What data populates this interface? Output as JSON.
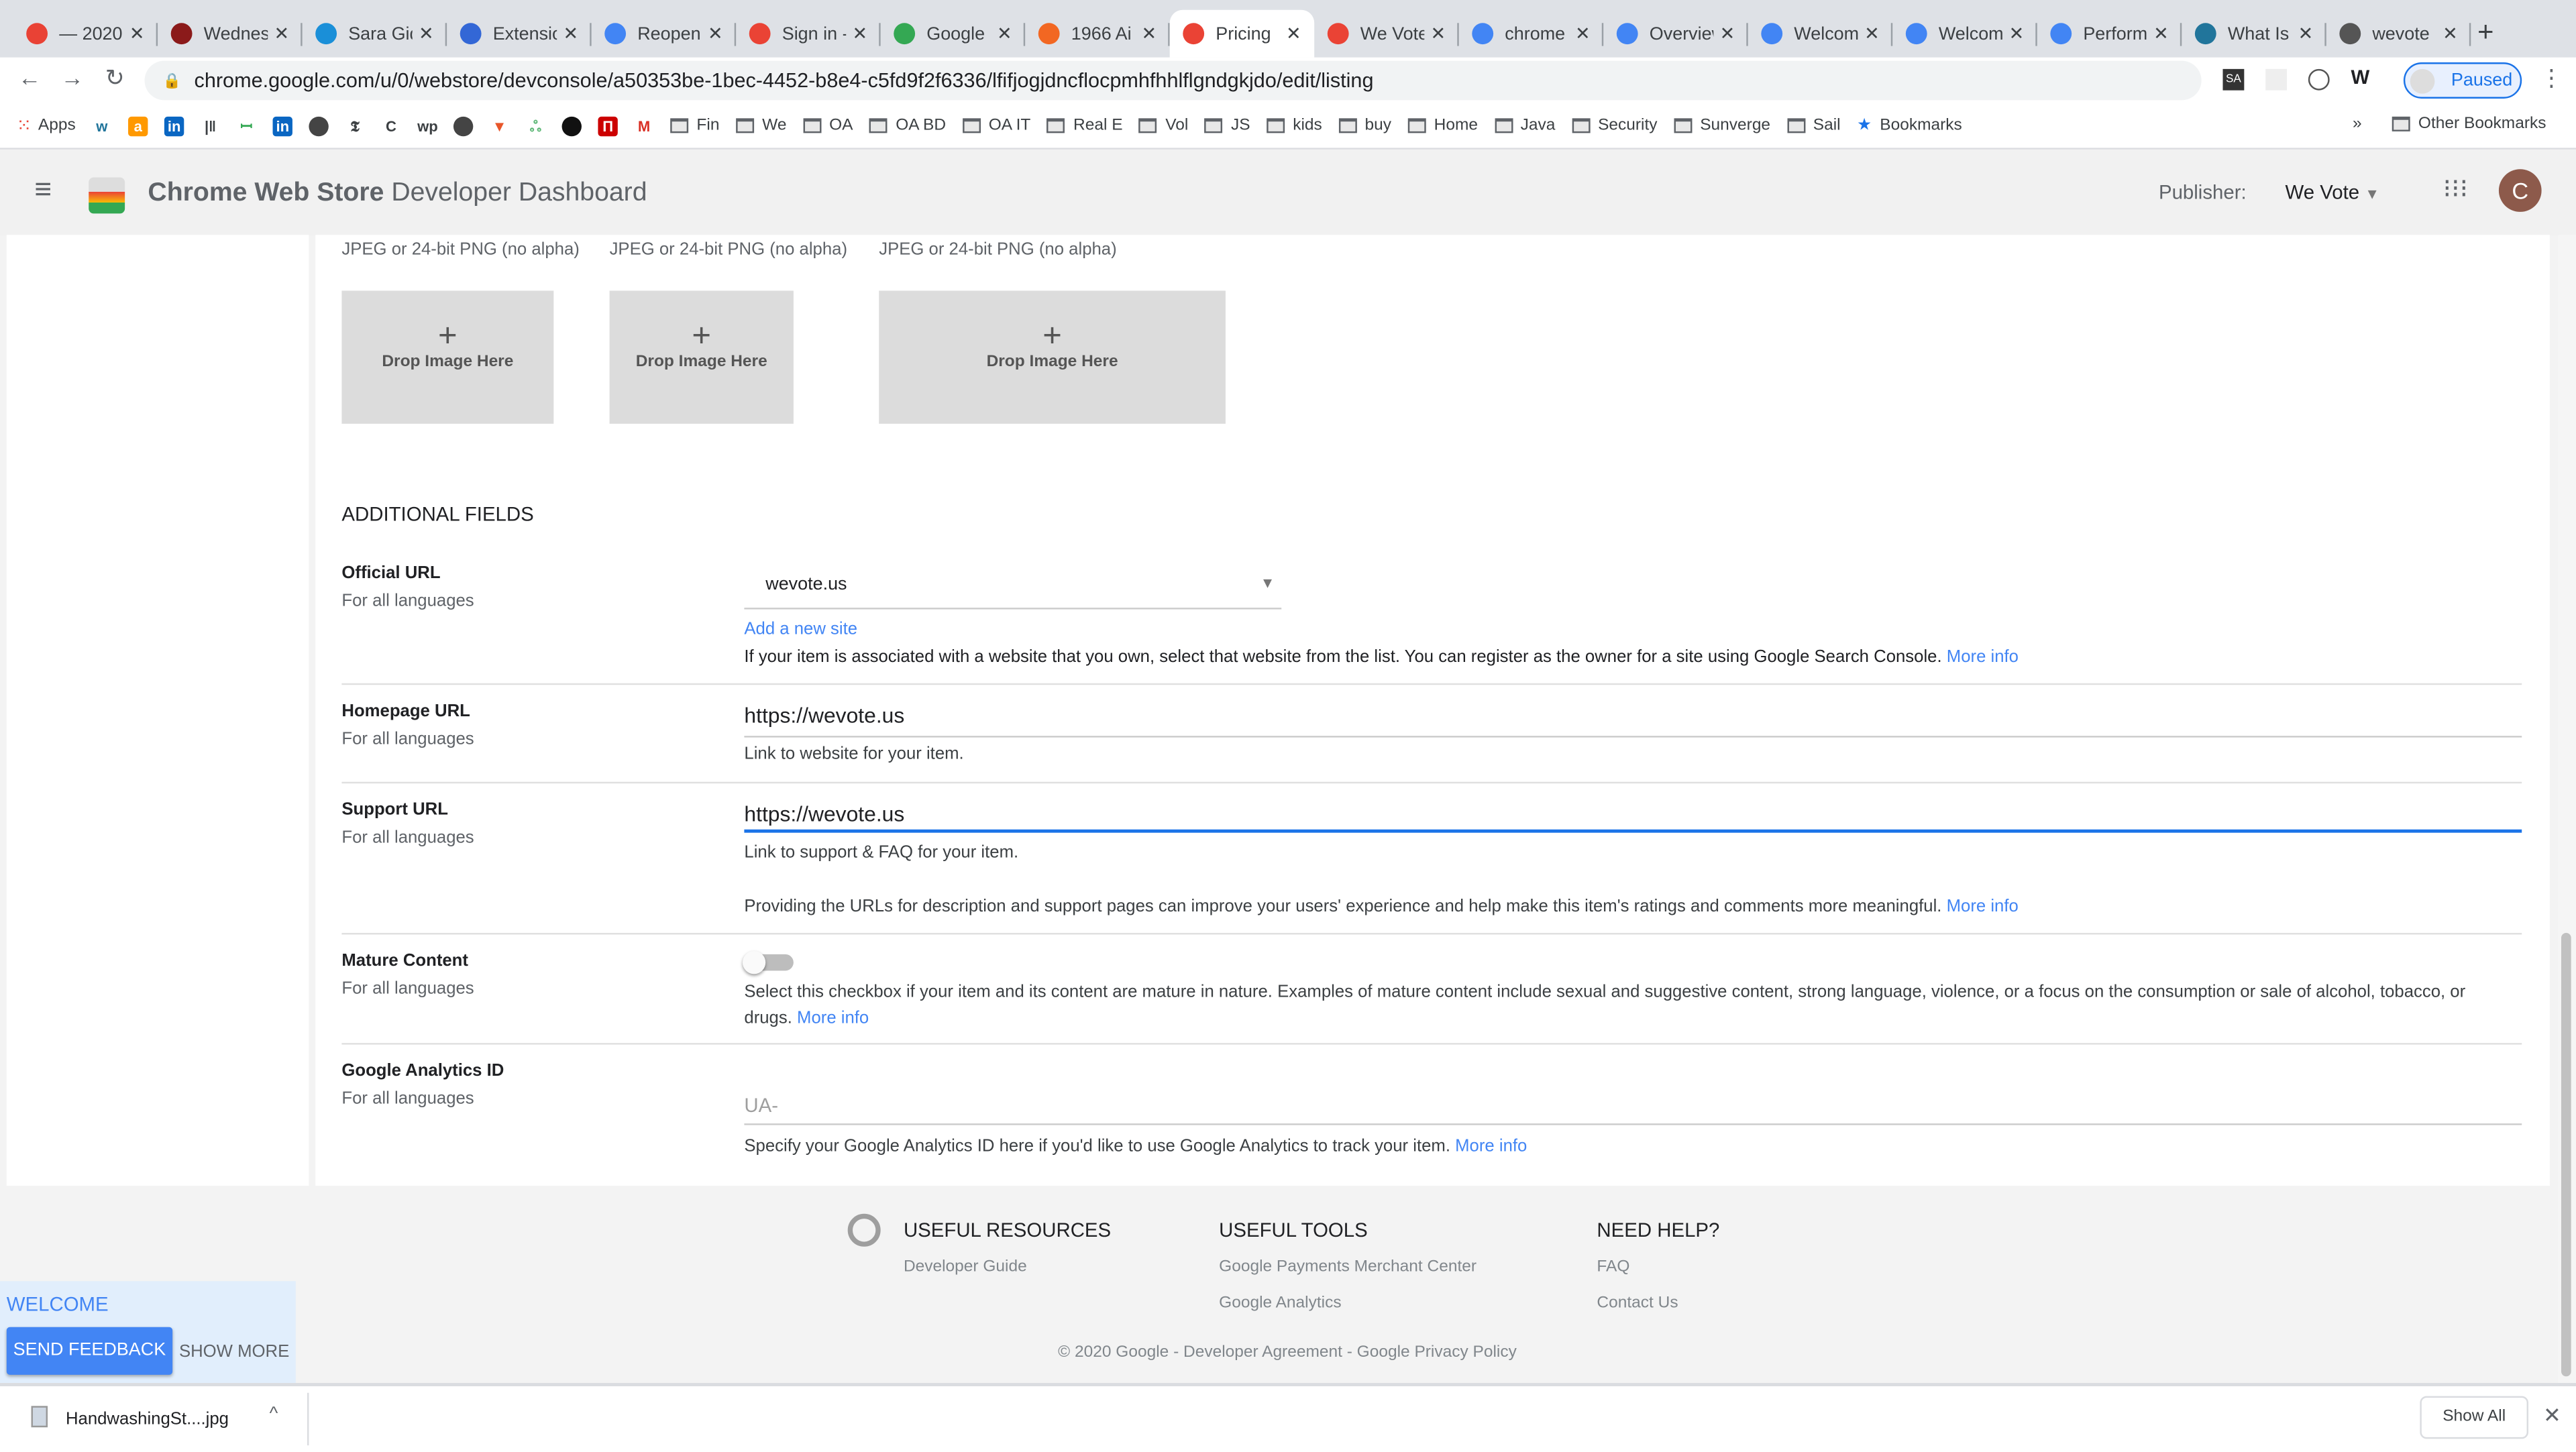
{
  "browser": {
    "tabs": [
      {
        "title": "— 2020",
        "icon": "chrome-store-icon",
        "color": "#e94235"
      },
      {
        "title": "Wednesday",
        "icon": "w-icon",
        "color": "#8b1a1a"
      },
      {
        "title": "Sara Gideon",
        "icon": "ab-icon",
        "color": "#1a8fd8"
      },
      {
        "title": "Extensions",
        "icon": "puzzle-icon",
        "color": "#3367d6"
      },
      {
        "title": "Reopen",
        "icon": "docs-icon",
        "color": "#4285f4"
      },
      {
        "title": "Sign in - Google",
        "icon": "google-icon",
        "color": "#ea4335"
      },
      {
        "title": "Google",
        "icon": "google-icon",
        "color": "#34a853"
      },
      {
        "title": "1966 Ai",
        "icon": "a-icon",
        "color": "#f26722"
      },
      {
        "title": "Pricing",
        "icon": "webstore-icon",
        "color": "#ea4335",
        "active": true
      },
      {
        "title": "We Vote",
        "icon": "webstore-icon",
        "color": "#ea4335"
      },
      {
        "title": "chrome",
        "icon": "google-icon",
        "color": "#4285f4"
      },
      {
        "title": "Overview",
        "icon": "wevote-icon",
        "color": "#4285f4"
      },
      {
        "title": "Welcome",
        "icon": "wevote-icon",
        "color": "#4285f4"
      },
      {
        "title": "Welcome",
        "icon": "wevote-icon",
        "color": "#4285f4"
      },
      {
        "title": "Performance",
        "icon": "wevote-icon",
        "color": "#4285f4"
      },
      {
        "title": "What Is",
        "icon": "wordpress-icon",
        "color": "#21759b"
      },
      {
        "title": "wevote",
        "icon": "globe-icon",
        "color": "#555555"
      }
    ],
    "url": "chrome.google.com/u/0/webstore/devconsole/a50353be-1bec-4452-b8e4-c5fd9f2f6336/lfifjogjdncflocpmhfhhlflgndgkjdo/edit/listing",
    "profile_label": "Paused",
    "bookmarks": {
      "apps": "Apps",
      "folders": [
        "Fin",
        "We",
        "OA",
        "OA BD",
        "OA IT",
        "Real E",
        "Vol",
        "JS",
        "kids",
        "buy",
        "Home",
        "Java",
        "Security",
        "Sunverge",
        "Sail"
      ],
      "bookmarks": "Bookmarks",
      "overflow": "»",
      "other": "Other Bookmarks"
    }
  },
  "app": {
    "title_bold": "Chrome Web Store",
    "title_rest": "Developer Dashboard",
    "publisher_label": "Publisher:",
    "publisher": "We Vote",
    "avatar": "C"
  },
  "images": {
    "format": "JPEG or 24-bit PNG (no alpha)",
    "drop": "Drop Image Here",
    "plus": "+"
  },
  "additional": {
    "heading": "ADDITIONAL FIELDS",
    "official_url": {
      "label": "Official URL",
      "sub": "For all languages",
      "value": "wevote.us",
      "add": "Add a new site",
      "help": "If your item is associated with a website that you own, select that website from the list. You can register as the owner for a site using Google Search Console.",
      "more": "More info"
    },
    "homepage_url": {
      "label": "Homepage URL",
      "sub": "For all languages",
      "value": "https://wevote.us",
      "help": "Link to website for your item."
    },
    "support_url": {
      "label": "Support URL",
      "sub": "For all languages",
      "value": "https://wevote.us",
      "help": "Link to support & FAQ for your item.",
      "note": "Providing the URLs for description and support pages can improve your users' experience and help make this item's ratings and comments more meaningful.",
      "more": "More info"
    },
    "mature": {
      "label": "Mature Content",
      "sub": "For all languages",
      "checked": false,
      "help": "Select this checkbox if your item and its content are mature in nature. Examples of mature content include sexual and suggestive content, strong language, violence, or a focus on the consumption or sale of alcohol, tobacco, or drugs.",
      "more": "More info"
    },
    "analytics": {
      "label": "Google Analytics ID",
      "sub": "For all languages",
      "placeholder": "UA-",
      "help": "Specify your Google Analytics ID here if you'd like to use Google Analytics to track your item.",
      "more": "More info"
    }
  },
  "footer": {
    "resources": {
      "title": "USEFUL RESOURCES",
      "links": [
        "Developer Guide"
      ]
    },
    "tools": {
      "title": "USEFUL TOOLS",
      "links": [
        "Google Payments Merchant Center",
        "Google Analytics"
      ]
    },
    "help": {
      "title": "NEED HELP?",
      "links": [
        "FAQ",
        "Contact Us"
      ]
    },
    "copyright": "© 2020 Google - Developer Agreement - Google Privacy Policy"
  },
  "welcome": {
    "title": "WELCOME",
    "send": "SEND FEEDBACK",
    "more": "SHOW MORE"
  },
  "downloads": {
    "file": "HandwashingSt....jpg",
    "show_all": "Show All"
  }
}
